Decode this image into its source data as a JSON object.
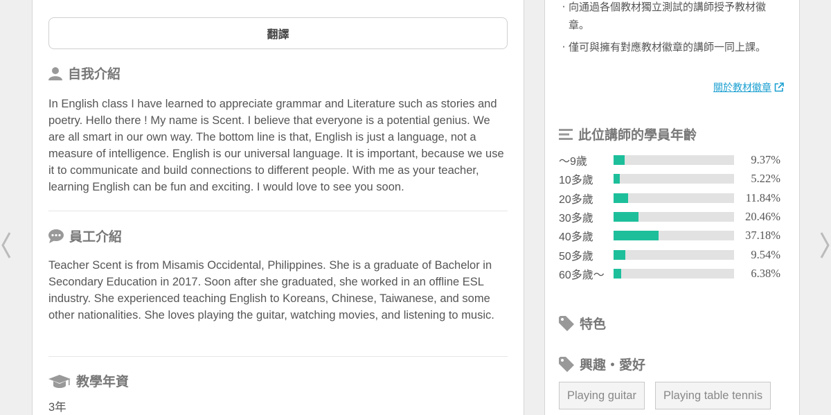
{
  "translate": {
    "label": "翻譯"
  },
  "self_intro": {
    "title": "自我介紹",
    "body": "In English class I have learned to appreciate grammar and Literature such as stories and poetry. Hello there ! My name is Scent. I believe that everyone is a potential genius. We are all smart in our own way. The bottom line is that, English is just a language, not a measure of intelligence. English is our universal language. It is important, because we use it to communicate and build connections to different people. With me as your teacher, learning English can be fun and exciting. I would love to see you soon."
  },
  "staff_intro": {
    "title": "員工介紹",
    "body": "Teacher Scent is from Misamis Occidental, Philippines. She is a graduate of Bachelor in Secondary Education in 2017. Soon after she graduated, she worked in an offline ESL industry. She experienced teaching English to Koreans, Chinese, Taiwanese, and some other nationalities. She loves playing the guitar, watching movies, and listening to music."
  },
  "experience": {
    "title": "教學年資",
    "value": "3年"
  },
  "badges": {
    "notes": [
      {
        "bullet": "·",
        "text": "向通過各個教材獨立測試的講師授予教材徽章。"
      },
      {
        "bullet": "·",
        "text": "僅可與擁有對應教材徽章的講師一同上課。"
      }
    ],
    "link_label": "關於教材徽章"
  },
  "age_stats": {
    "title": "此位講師的學員年齡",
    "rows": [
      {
        "label": "～9歲",
        "percent_text": "9.37%",
        "value": 9.37
      },
      {
        "label": "10多歲",
        "percent_text": "5.22%",
        "value": 5.22
      },
      {
        "label": "20多歲",
        "percent_text": "11.84%",
        "value": 11.84
      },
      {
        "label": "30多歲",
        "percent_text": "20.46%",
        "value": 20.46
      },
      {
        "label": "40多歲",
        "percent_text": "37.18%",
        "value": 37.18
      },
      {
        "label": "50多歲",
        "percent_text": "9.54%",
        "value": 9.54
      },
      {
        "label": "60多歲～",
        "percent_text": "6.38%",
        "value": 6.38
      }
    ],
    "bar_color": "#1dbf9b"
  },
  "features": {
    "title": "特色"
  },
  "hobbies": {
    "title": "興趣・愛好",
    "tags": [
      "Playing guitar",
      "Playing table tennis"
    ]
  },
  "icons": {
    "prev": "chevron-left-icon",
    "next": "chevron-right-icon",
    "self_intro": "user-icon",
    "staff_intro": "chat-bubble-icon",
    "experience": "graduation-cap-icon",
    "age_stats": "bar-list-icon",
    "tag": "tag-icon",
    "external": "external-link-icon"
  }
}
